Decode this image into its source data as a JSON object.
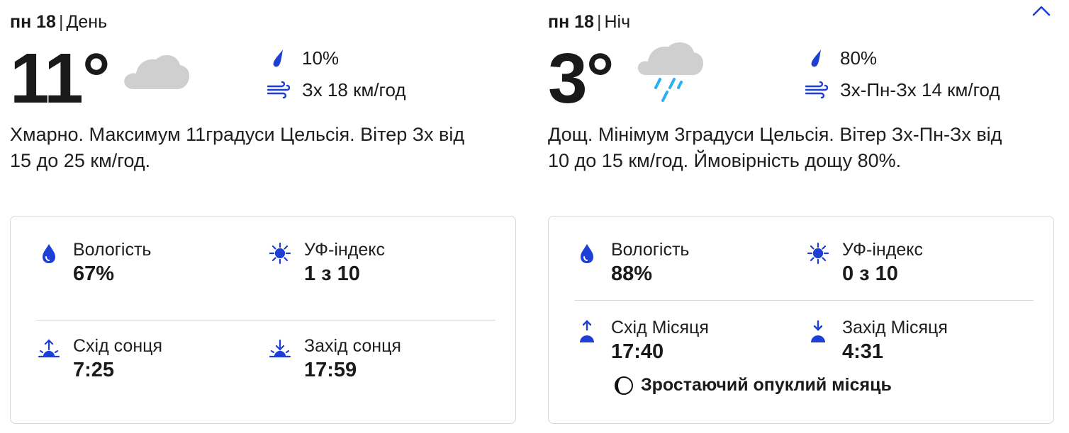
{
  "colors": {
    "accent": "#1d3fd6",
    "cloud": "#cfcfcf",
    "rain": "#2ab0f0",
    "border": "#d5d5d5"
  },
  "day": {
    "weekday": "пн 18",
    "part": "День",
    "temp": "11°",
    "icon": "cloudy-icon",
    "precip": "10%",
    "wind": "Зх 18 км/год",
    "description": "Хмарно. Максимум 11градуси Цельсія. Вітер Зх від 15 до 25 км/год.",
    "humidity": {
      "label": "Вологість",
      "value": "67%"
    },
    "uv": {
      "label": "УФ-індекс",
      "value": "1 з 10"
    },
    "rise": {
      "label": "Схід сонця",
      "value": "7:25"
    },
    "set": {
      "label": "Захід сонця",
      "value": "17:59"
    }
  },
  "night": {
    "weekday": "пн 18",
    "part": "Ніч",
    "temp": "3°",
    "icon": "rain-icon",
    "precip": "80%",
    "wind": "Зх-Пн-Зх 14 км/год",
    "description": "Дощ. Мінімум 3градуси Цельсія. Вітер Зх-Пн-Зх від 10 до 15 км/год. Ймовірність дощу 80%.",
    "humidity": {
      "label": "Вологість",
      "value": "88%"
    },
    "uv": {
      "label": "УФ-індекс",
      "value": "0 з 10"
    },
    "rise": {
      "label": "Схід Місяця",
      "value": "17:40"
    },
    "set": {
      "label": "Захід Місяця",
      "value": "4:31"
    },
    "moon_phase": "Зростаючий опуклий місяць"
  }
}
